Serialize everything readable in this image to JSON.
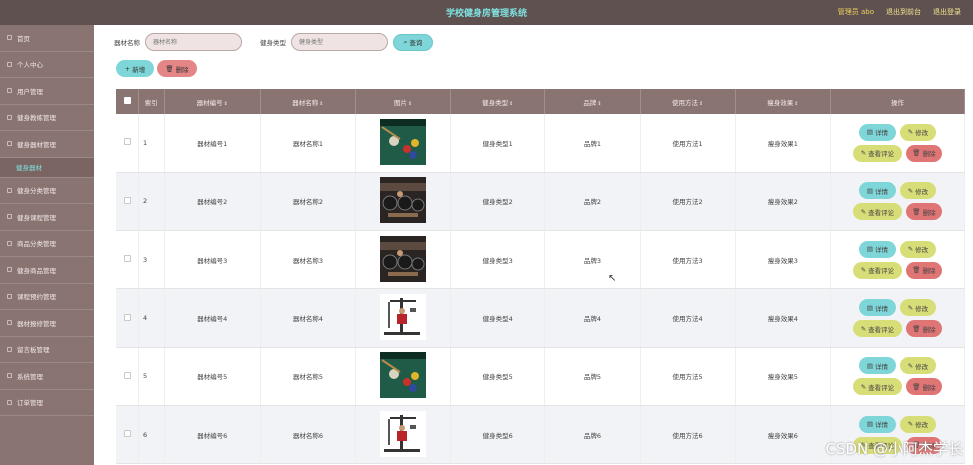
{
  "header": {
    "title": "学校健身房管理系统",
    "user": "管理员 abo",
    "link_front": "退出到前台",
    "link_logout": "退出登录"
  },
  "sidebar": {
    "items": [
      {
        "label": "首页"
      },
      {
        "label": "个人中心"
      },
      {
        "label": "用户管理"
      },
      {
        "label": "健身教练管理"
      },
      {
        "label": "健身器材管理"
      },
      {
        "label": "健身器材",
        "sub": true
      },
      {
        "label": "健身分类管理"
      },
      {
        "label": "健身课程管理"
      },
      {
        "label": "商品分类管理"
      },
      {
        "label": "健身商品管理"
      },
      {
        "label": "课程预约管理"
      },
      {
        "label": "器材报修管理"
      },
      {
        "label": "留言板管理"
      },
      {
        "label": "系统管理"
      },
      {
        "label": "订单管理"
      }
    ]
  },
  "search": {
    "name_label": "器材名称",
    "name_placeholder": "器材名称",
    "type_label": "健身类型",
    "type_placeholder": "健身类型",
    "query_label": "查询"
  },
  "toolbar": {
    "add_label": "新增",
    "delete_label": "删除"
  },
  "table": {
    "columns": [
      "索引",
      "器材编号",
      "器材名称",
      "图片",
      "健身类型",
      "品牌",
      "使用方法",
      "瘦身效果",
      "操作"
    ],
    "rows": [
      {
        "index": "1",
        "code": "器材编号1",
        "name": "器材名称1",
        "image": "billiards-image",
        "type": "健身类型1",
        "brand": "品牌1",
        "usage": "使用方法1",
        "effect": "瘦身效果1"
      },
      {
        "index": "2",
        "code": "器材编号2",
        "name": "器材名称2",
        "image": "gym-image",
        "type": "健身类型2",
        "brand": "品牌2",
        "usage": "使用方法2",
        "effect": "瘦身效果2"
      },
      {
        "index": "3",
        "code": "器材编号3",
        "name": "器材名称3",
        "image": "gym-image",
        "type": "健身类型3",
        "brand": "品牌3",
        "usage": "使用方法3",
        "effect": "瘦身效果3"
      },
      {
        "index": "4",
        "code": "器材编号4",
        "name": "器材名称4",
        "image": "multi-gym-image",
        "type": "健身类型4",
        "brand": "品牌4",
        "usage": "使用方法4",
        "effect": "瘦身效果4"
      },
      {
        "index": "5",
        "code": "器材编号5",
        "name": "器材名称5",
        "image": "billiards-image",
        "type": "健身类型5",
        "brand": "品牌5",
        "usage": "使用方法5",
        "effect": "瘦身效果5"
      },
      {
        "index": "6",
        "code": "器材编号6",
        "name": "器材名称6",
        "image": "multi-gym-image",
        "type": "健身类型6",
        "brand": "品牌6",
        "usage": "使用方法6",
        "effect": "瘦身效果6"
      }
    ],
    "actions": {
      "detail": "详情",
      "edit": "修改",
      "review": "查看评论",
      "remove": "删除"
    }
  },
  "watermark": "CSDN @小阿杰学长"
}
